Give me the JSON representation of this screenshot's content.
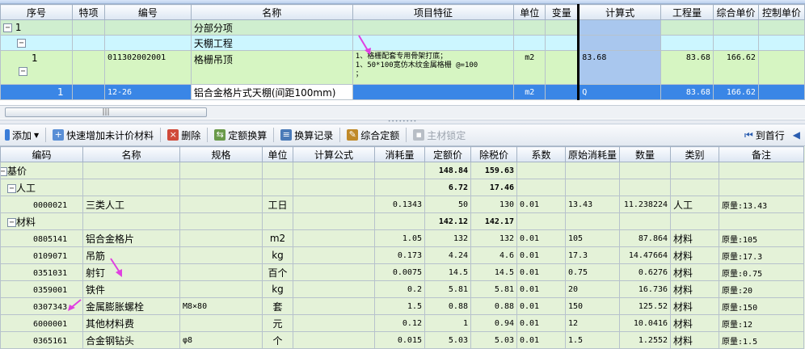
{
  "top": {
    "group_strip_text": "",
    "columns": [
      "序号",
      "特项",
      "编号",
      "名称",
      "项目特征",
      "单位",
      "变量",
      "计算式",
      "工程量",
      "综合单价",
      "控制单价"
    ],
    "rows": [
      {
        "seq": "1",
        "special": "",
        "code": "",
        "name": "分部分项",
        "feature": "",
        "unit": "",
        "variable": "",
        "formula": "",
        "qty": "",
        "price": "",
        "ctrl": ""
      },
      {
        "seq": "",
        "special": "",
        "code": "",
        "name": "天棚工程",
        "feature": "",
        "unit": "",
        "variable": "",
        "formula": "",
        "qty": "",
        "price": "",
        "ctrl": ""
      },
      {
        "seq": "1",
        "special": "",
        "code": "011302002001",
        "name": "格栅吊顶",
        "feature": "1、格栅配套专用骨架打底；\n1、50*100宽仿木纹金属格栅 @=100\n；",
        "unit": "m2",
        "variable": "",
        "formula": "83.68",
        "qty": "83.68",
        "price": "166.62",
        "ctrl": ""
      },
      {
        "seq": "1",
        "special": "",
        "code": "12-26",
        "name": "铝合金格片式天棚(间距100mm)",
        "feature": "",
        "unit": "m2",
        "variable": "",
        "formula": "Q",
        "qty": "83.68",
        "price": "166.62",
        "ctrl": ""
      }
    ],
    "scroll_thumb": "|||"
  },
  "toolbar": {
    "add": "添加",
    "quick_add": "快速增加未计价材料",
    "delete": "删除",
    "quota_convert": "定额换算",
    "convert_record": "换算记录",
    "combined_quota": "综合定额",
    "main_material_lock": "主材锁定",
    "goto_first": "到首行"
  },
  "bottom": {
    "columns": [
      "编码",
      "名称",
      "规格",
      "单位",
      "计算公式",
      "消耗量",
      "定额价",
      "除税价",
      "系数",
      "原始消耗量",
      "数量",
      "类别",
      "备注"
    ],
    "rows": [
      {
        "code": "基价",
        "name": "",
        "spec": "",
        "unit": "",
        "formula": "",
        "consume": "",
        "quota": "148.84",
        "taxfree": "159.63",
        "coef": "",
        "orig": "",
        "amount": "",
        "cat": "",
        "note": "",
        "level": 0,
        "bold": true
      },
      {
        "code": "人工",
        "name": "",
        "spec": "",
        "unit": "",
        "formula": "",
        "consume": "",
        "quota": "6.72",
        "taxfree": "17.46",
        "coef": "",
        "orig": "",
        "amount": "",
        "cat": "",
        "note": "",
        "level": 1,
        "bold": true
      },
      {
        "code": "0000021",
        "name": "三类人工",
        "spec": "",
        "unit": "工日",
        "formula": "",
        "consume": "0.1343",
        "quota": "50",
        "taxfree": "130",
        "coef": "0.01",
        "orig": "13.43",
        "amount": "11.238224",
        "cat": "人工",
        "note": "原量:13.43",
        "level": 2,
        "bold": false
      },
      {
        "code": "材料",
        "name": "",
        "spec": "",
        "unit": "",
        "formula": "",
        "consume": "",
        "quota": "142.12",
        "taxfree": "142.17",
        "coef": "",
        "orig": "",
        "amount": "",
        "cat": "",
        "note": "",
        "level": 1,
        "bold": true
      },
      {
        "code": "0805141",
        "name": "铝合金格片",
        "spec": "",
        "unit": "m2",
        "formula": "",
        "consume": "1.05",
        "quota": "132",
        "taxfree": "132",
        "coef": "0.01",
        "orig": "105",
        "amount": "87.864",
        "cat": "材料",
        "note": "原量:105",
        "level": 2,
        "bold": false
      },
      {
        "code": "0109071",
        "name": "吊筋",
        "spec": "",
        "unit": "kg",
        "formula": "",
        "consume": "0.173",
        "quota": "4.24",
        "taxfree": "4.6",
        "coef": "0.01",
        "orig": "17.3",
        "amount": "14.47664",
        "cat": "材料",
        "note": "原量:17.3",
        "level": 2,
        "bold": false
      },
      {
        "code": "0351031",
        "name": "射钉",
        "spec": "",
        "unit": "百个",
        "formula": "",
        "consume": "0.0075",
        "quota": "14.5",
        "taxfree": "14.5",
        "coef": "0.01",
        "orig": "0.75",
        "amount": "0.6276",
        "cat": "材料",
        "note": "原量:0.75",
        "level": 2,
        "bold": false
      },
      {
        "code": "0359001",
        "name": "铁件",
        "spec": "",
        "unit": "kg",
        "formula": "",
        "consume": "0.2",
        "quota": "5.81",
        "taxfree": "5.81",
        "coef": "0.01",
        "orig": "20",
        "amount": "16.736",
        "cat": "材料",
        "note": "原量:20",
        "level": 2,
        "bold": false
      },
      {
        "code": "0307343",
        "name": "金属膨胀螺栓",
        "spec": "M8×80",
        "unit": "套",
        "formula": "",
        "consume": "1.5",
        "quota": "0.88",
        "taxfree": "0.88",
        "coef": "0.01",
        "orig": "150",
        "amount": "125.52",
        "cat": "材料",
        "note": "原量:150",
        "level": 2,
        "bold": false
      },
      {
        "code": "6000001",
        "name": "其他材料费",
        "spec": "",
        "unit": "元",
        "formula": "",
        "consume": "0.12",
        "quota": "1",
        "taxfree": "0.94",
        "coef": "0.01",
        "orig": "12",
        "amount": "10.0416",
        "cat": "材料",
        "note": "原量:12",
        "level": 2,
        "bold": false
      },
      {
        "code": "0365161",
        "name": "合金钢钻头",
        "spec": "φ8",
        "unit": "个",
        "formula": "",
        "consume": "0.015",
        "quota": "5.03",
        "taxfree": "5.03",
        "coef": "0.01",
        "orig": "1.5",
        "amount": "1.2552",
        "cat": "材料",
        "note": "原量:1.5",
        "level": 2,
        "bold": false
      }
    ]
  },
  "colors": {
    "green_row": "#cfeecf",
    "cyan_row": "#ccf6ff",
    "lime_row": "#d6f5c2",
    "selected_row": "#3a86e6",
    "formula_col": "#a9c7ee",
    "bottom_bg": "#e4f2d8",
    "annotation_arrow": "#e040e0"
  }
}
